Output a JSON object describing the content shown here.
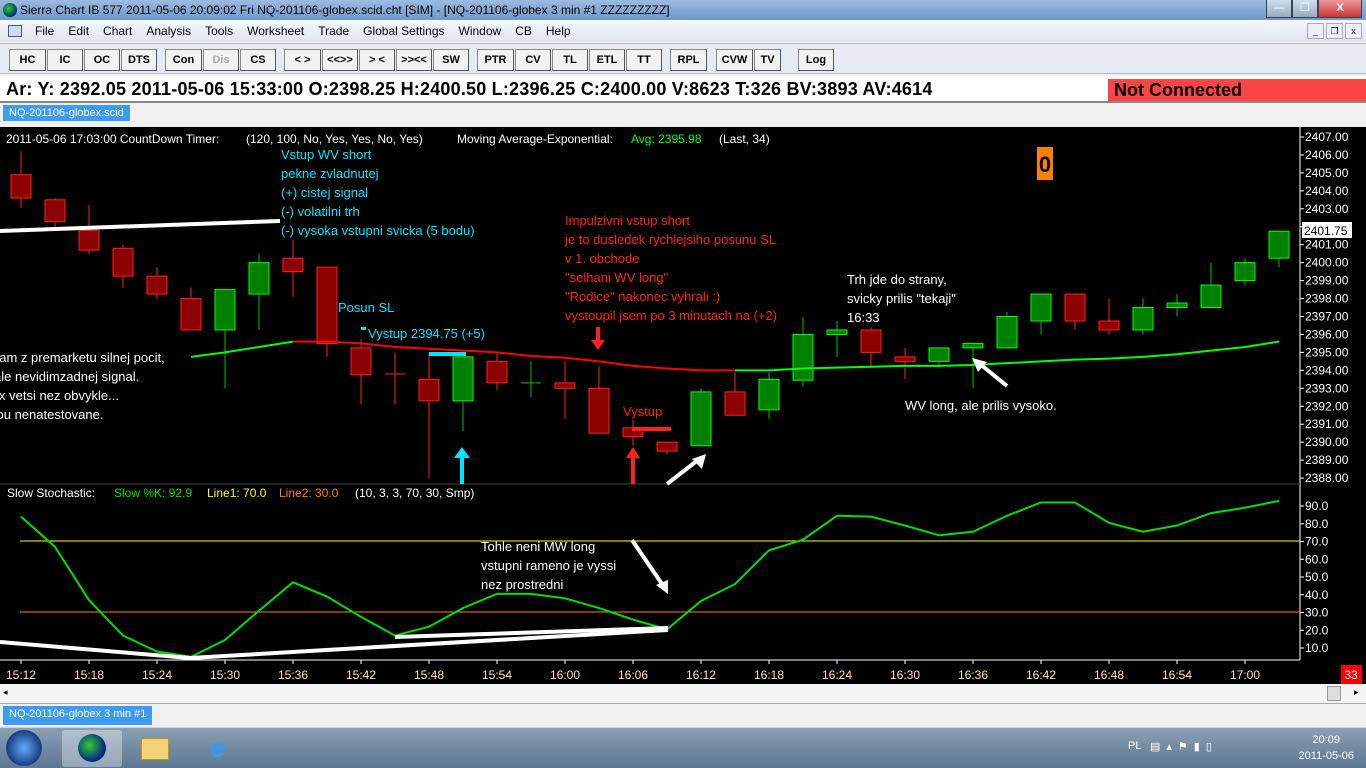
{
  "window": {
    "title": "Sierra Chart IB 577  2011-05-06  20:09:02  Fri   NQ-201106-globex.scid.cht [SIM] - [NQ-201106-globex  3 min   #1  ZZZZZZZZZ]",
    "min": "—",
    "restore": "❐",
    "close": "X"
  },
  "menu": [
    "File",
    "Edit",
    "Chart",
    "Analysis",
    "Tools",
    "Worksheet",
    "Trade",
    "Global Settings",
    "Window",
    "CB",
    "Help"
  ],
  "mdi": {
    "min": "_",
    "restore": "❐",
    "close": "x"
  },
  "toolbar": [
    "HC",
    "IC",
    "OC",
    "DTS",
    "Con",
    "Dis",
    "CS",
    "< >",
    "<<>>",
    "> <",
    ">><<",
    "SW",
    "PTR",
    "CV",
    "TL",
    "ETL",
    "TT",
    "RPL",
    "CVW",
    "TV",
    "Log"
  ],
  "status": {
    "text": "Ar: Y: 2392.05  2011-05-06  15:33:00  O:2398.25  H:2400.50  L:2396.25  C:2400.00  V:8623  T:326  BV:3893  AV:4614",
    "connection": "Not Connected"
  },
  "top_tab": "NQ-201106-globex.scid",
  "bottom_tab": "NQ-201106-globex  3 min   #1",
  "chart_header": {
    "timer": "2011-05-06 17:03:00 CountDown Timer:",
    "timer_params": "(120, 100, No, Yes, Yes, No, Yes)",
    "ma_label": "Moving Average-Exponential:",
    "ma_value": "Avg: 2395.98",
    "ma_params": "(Last, 34)"
  },
  "stoch_header": {
    "label": "Slow Stochastic:",
    "k": "Slow %K: 92.9",
    "line1": "Line1: 70.0",
    "line2": "Line2: 30.0",
    "params": "(10, 3, 3, 70, 30, Smp)"
  },
  "countdown_box": "0",
  "bars_remaining": "33",
  "last_price": "2401.75",
  "annotations": {
    "cyan_block": [
      "Vstup WV short",
      "pekne zvladnutej",
      "(+) cistej signal",
      "(-) volatilni trh",
      "(-) vysoka vstupni svicka (5 bodu)"
    ],
    "posun": "Posun SL",
    "vystup1": "Vystup 2394.75 (+5)",
    "white_left": [
      "nam z premarketu silnej pocit,",
      "ale nevidimzadnej signal.",
      "x vetsi nez obvykle...",
      "sou nenatestovane."
    ],
    "red_block": [
      "Impulzivni vstup short",
      "je to dusledek rychlejsiho posunu SL",
      "v 1. obchode",
      "\"selhani WV long\"",
      "\"Rodice\" nakonec vyhrali :)",
      "vystoupil jsem po 3 minutach na (+2)"
    ],
    "vystup2": "Vystup",
    "trh": [
      "Trh jde do strany,",
      "svicky prilis \"tekaji\"",
      "16:33"
    ],
    "wv_long": "WV long, ale prilis vysoko.",
    "stoch_note": [
      "Tohle neni MW long",
      "vstupni rameno je vyssi",
      "nez prostredni"
    ]
  },
  "tray": {
    "lang": "PL",
    "time": "20:09",
    "date": "2011-05-06"
  },
  "colors": {
    "up": "#008000",
    "down": "#8b0000",
    "ema_up": "#00ff00",
    "ema_down": "#ff0000",
    "k": "#00e000",
    "line1": "#ffff00",
    "line2": "#ff8000"
  },
  "chart_data": {
    "type": "candlestick",
    "symbol": "NQ-201106-globex",
    "interval": "3 min",
    "times": [
      "15:12",
      "15:15",
      "15:18",
      "15:21",
      "15:24",
      "15:27",
      "15:30",
      "15:33",
      "15:36",
      "15:39",
      "15:42",
      "15:45",
      "15:48",
      "15:51",
      "15:54",
      "15:57",
      "16:00",
      "16:03",
      "16:06",
      "16:09",
      "16:12",
      "16:15",
      "16:18",
      "16:21",
      "16:24",
      "16:27",
      "16:30",
      "16:33",
      "16:36",
      "16:39",
      "16:42",
      "16:45",
      "16:48",
      "16:51",
      "16:54",
      "16:57",
      "17:00",
      "17:03"
    ],
    "time_ticks": [
      "15:12",
      "15:18",
      "15:24",
      "15:30",
      "15:36",
      "15:42",
      "15:48",
      "15:54",
      "16:00",
      "16:06",
      "16:12",
      "16:18",
      "16:24",
      "16:30",
      "16:36",
      "16:42",
      "16:48",
      "16:54",
      "17:00"
    ],
    "ohlc": [
      [
        2404.9,
        2406.2,
        2403.05,
        2403.6
      ],
      [
        2403.5,
        2403.6,
        2402.0,
        2402.3
      ],
      [
        2401.8,
        2403.2,
        2400.5,
        2400.7
      ],
      [
        2400.8,
        2401.0,
        2398.6,
        2399.25
      ],
      [
        2399.25,
        2399.75,
        2398.0,
        2398.25
      ],
      [
        2398.0,
        2398.6,
        2396.25,
        2396.25
      ],
      [
        2396.25,
        2398.5,
        2393.0,
        2398.5
      ],
      [
        2398.25,
        2400.5,
        2396.25,
        2400.0
      ],
      [
        2400.25,
        2401.25,
        2398.1,
        2399.5
      ],
      [
        2399.75,
        2399.75,
        2394.75,
        2395.5
      ],
      [
        2395.25,
        2395.75,
        2392.1,
        2393.75
      ],
      [
        2393.8,
        2395.0,
        2392.1,
        2393.75
      ],
      [
        2393.5,
        2394.9,
        2388.0,
        2392.3
      ],
      [
        2392.3,
        2394.75,
        2390.6,
        2394.75
      ],
      [
        2394.5,
        2395.0,
        2392.9,
        2393.3
      ],
      [
        2393.3,
        2394.5,
        2392.5,
        2393.3
      ],
      [
        2393.3,
        2394.5,
        2391.3,
        2393.0
      ],
      [
        2393.0,
        2394.25,
        2390.5,
        2390.5
      ],
      [
        2390.8,
        2391.25,
        2389.8,
        2390.3
      ],
      [
        2390.0,
        2390.0,
        2389.3,
        2389.5
      ],
      [
        2389.8,
        2393.0,
        2389.8,
        2392.8
      ],
      [
        2392.8,
        2393.9,
        2391.5,
        2391.5
      ],
      [
        2391.8,
        2393.85,
        2391.3,
        2393.5
      ],
      [
        2393.45,
        2396.95,
        2393.1,
        2396.0
      ],
      [
        2396.0,
        2396.75,
        2394.75,
        2396.25
      ],
      [
        2396.25,
        2396.4,
        2394.25,
        2395.0
      ],
      [
        2394.75,
        2395.25,
        2393.5,
        2394.5
      ],
      [
        2394.5,
        2395.25,
        2394.1,
        2395.25
      ],
      [
        2395.25,
        2395.5,
        2393.0,
        2395.5
      ],
      [
        2395.25,
        2397.25,
        2395.25,
        2397.0
      ],
      [
        2396.75,
        2398.25,
        2396.0,
        2398.25
      ],
      [
        2398.25,
        2398.25,
        2396.25,
        2396.75
      ],
      [
        2396.75,
        2398.0,
        2396.0,
        2396.25
      ],
      [
        2396.25,
        2398.0,
        2396.0,
        2397.5
      ],
      [
        2397.5,
        2398.25,
        2397.0,
        2397.75
      ],
      [
        2397.5,
        2400.0,
        2397.5,
        2398.75
      ],
      [
        2399.0,
        2400.25,
        2398.75,
        2400.0
      ],
      [
        2400.25,
        2401.75,
        2399.75,
        2401.75
      ]
    ],
    "ema_start_index": 5,
    "ema": [
      2394.75,
      2395.0,
      2395.3,
      2395.6,
      2395.6,
      2395.5,
      2395.3,
      2395.2,
      2395.1,
      2395.0,
      2394.8,
      2394.7,
      2394.5,
      2394.25,
      2394.1,
      2394.0,
      2394.0,
      2394.0,
      2394.1,
      2394.15,
      2394.2,
      2394.25,
      2394.25,
      2394.3,
      2394.4,
      2394.5,
      2394.6,
      2394.65,
      2394.75,
      2394.9,
      2395.1,
      2395.3,
      2395.6
    ],
    "price_axis": {
      "min": 2388,
      "max": 2407,
      "step": 1
    },
    "stoch_k": [
      84,
      67,
      37,
      17,
      8,
      5,
      14.5,
      31,
      47,
      39,
      27.5,
      17,
      22,
      32.5,
      40.5,
      40.5,
      38,
      32.5,
      26,
      20.5,
      36.5,
      46,
      65,
      71,
      84.5,
      84,
      79,
      73.5,
      75.5,
      84.5,
      92,
      92,
      80.5,
      75.5,
      79,
      86,
      89,
      92.9
    ],
    "stoch_axis": {
      "min": 10,
      "max": 90,
      "step": 10
    },
    "line1": 70,
    "line2": 30
  }
}
